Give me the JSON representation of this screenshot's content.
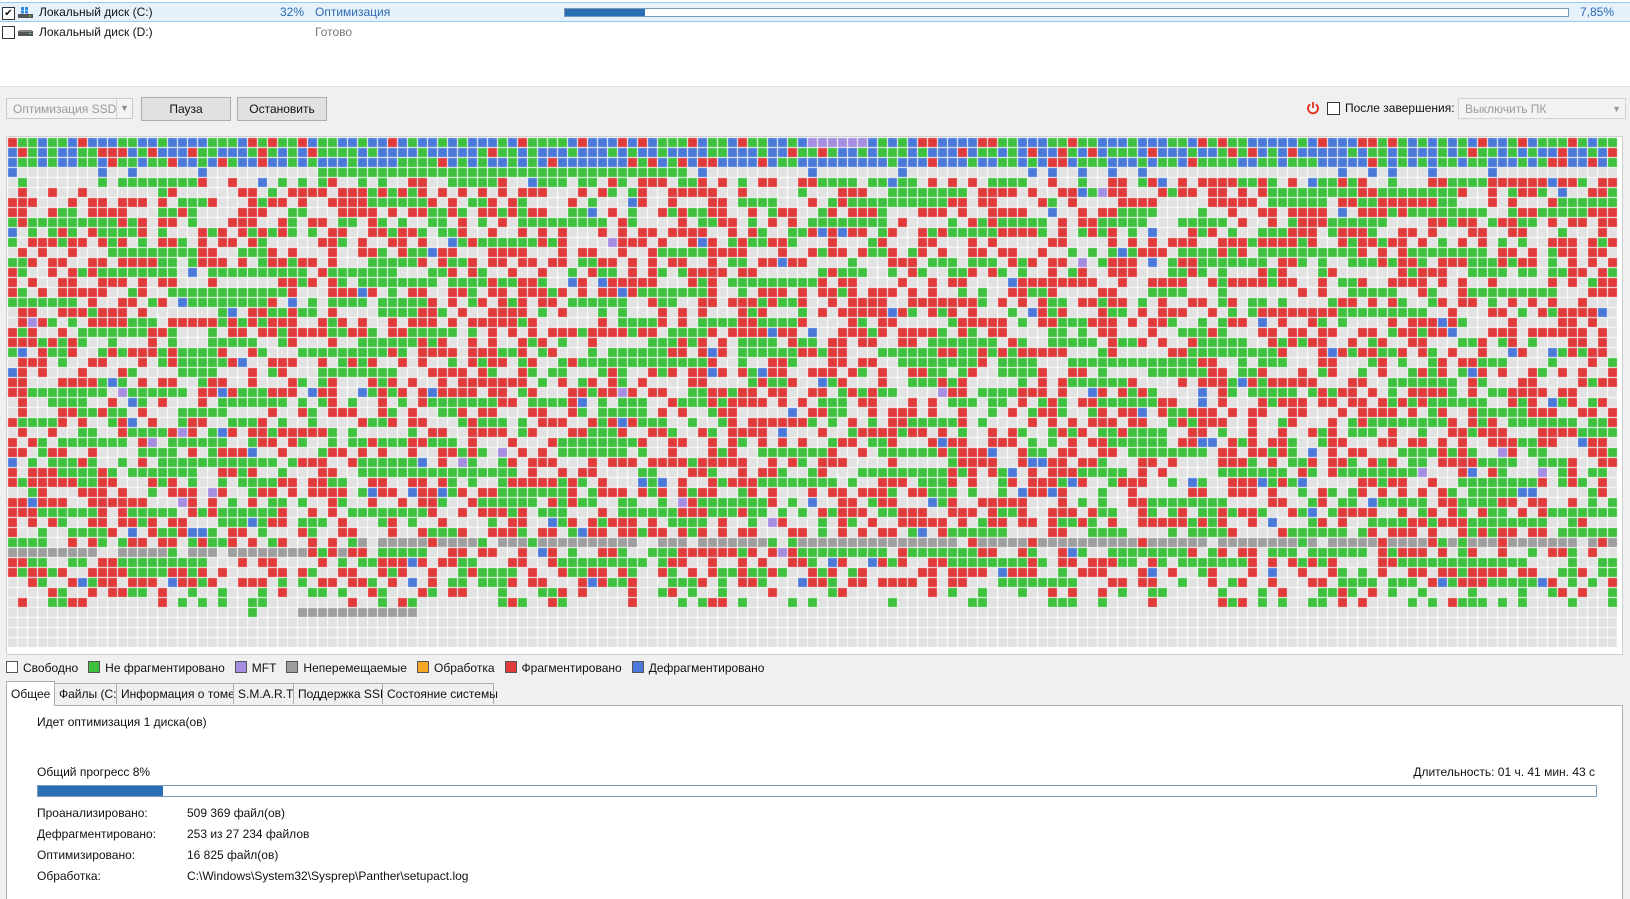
{
  "drives": [
    {
      "checked": true,
      "check_glyph": "✔",
      "name": "Локальный диск (C:)",
      "percent": "32%",
      "status": "Оптимизация",
      "progress": 0.08,
      "frag_percent": "7,85%",
      "icon": "system-drive-icon"
    },
    {
      "checked": false,
      "check_glyph": "",
      "name": "Локальный диск (D:)",
      "percent": "",
      "status": "Готово",
      "icon": "drive-icon"
    }
  ],
  "toolbar": {
    "mode_label": "Оптимизация SSD",
    "pause_label": "Пауза",
    "stop_label": "Остановить",
    "after_label": "После завершения:",
    "after_value": "Выключить ПК",
    "power_icon": "power-icon"
  },
  "cluster_map": {
    "legend_colors": {
      "free": "#e2e2e2",
      "not_fragmented": "#3ec13e",
      "mft": "#a58ee0",
      "unmovable": "#9e9e9e",
      "processing": "#f5a623",
      "fragmented": "#e03a3a",
      "defragmented": "#4a79d9"
    }
  },
  "legend": [
    {
      "label": "Свободно",
      "color": "#ffffff"
    },
    {
      "label": "Не фрагментировано",
      "color": "#3ec13e"
    },
    {
      "label": "MFT",
      "color": "#a58ee0"
    },
    {
      "label": "Неперемещаемые",
      "color": "#9e9e9e"
    },
    {
      "label": "Обработка",
      "color": "#f5a623"
    },
    {
      "label": "Фрагментировано",
      "color": "#e03a3a"
    },
    {
      "label": "Дефрагментировано",
      "color": "#4a79d9"
    }
  ],
  "tabs": [
    "Общее",
    "Файлы (C:)",
    "Информация о томе",
    "S.M.A.R.T.",
    "Поддержка SSD",
    "Состояние системы"
  ],
  "general": {
    "heading": "Идет оптимизация 1 диска(ов)",
    "overall_label": "Общий прогресс 8%",
    "overall_progress": 0.08,
    "duration": "Длительность: 01 ч. 41 мин. 43 с",
    "stats": [
      {
        "label": "Проанализировано:",
        "value": "509 369 файл(ов)"
      },
      {
        "label": "Дефрагментировано:",
        "value": "253 из 27 234 файлов"
      },
      {
        "label": "Оптимизировано:",
        "value": "16 825 файл(ов)"
      },
      {
        "label": "Обработка:",
        "value": "C:\\Windows\\System32\\Sysprep\\Panther\\setupact.log"
      }
    ]
  }
}
